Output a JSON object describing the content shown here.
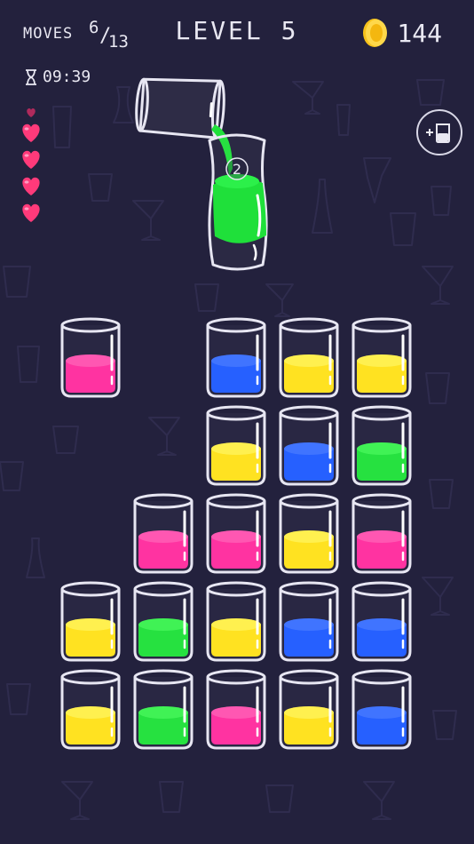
{
  "hud": {
    "moves_label": "MOVES",
    "moves_current": "6",
    "moves_total": "13",
    "level_label": "LEVEL 5",
    "coins": "144",
    "timer": "09:39"
  },
  "lives": {
    "total": 5,
    "filled": 4
  },
  "pour_badge": "2",
  "colors": {
    "background": "#23213d",
    "pink": "#ff2d9e",
    "blue": "#1f5bff",
    "yellow": "#ffe21a",
    "green": "#1fe03a",
    "heart": "#ff3a7a",
    "coin": "#f7c21a"
  },
  "icons": {
    "coin": "coin-icon",
    "timer": "hourglass-icon",
    "lives": "heart-icon",
    "add_tube": "add-tube-icon"
  },
  "board": {
    "rows": [
      [
        "pink",
        null,
        "blue",
        "yellow",
        "yellow"
      ],
      [
        null,
        null,
        "yellow",
        "blue",
        "green"
      ],
      [
        null,
        "pink",
        "pink",
        "yellow",
        "pink"
      ],
      [
        "yellow",
        "green",
        "yellow",
        "blue",
        "blue"
      ],
      [
        "yellow",
        "green",
        "pink",
        "yellow",
        "blue"
      ]
    ]
  }
}
